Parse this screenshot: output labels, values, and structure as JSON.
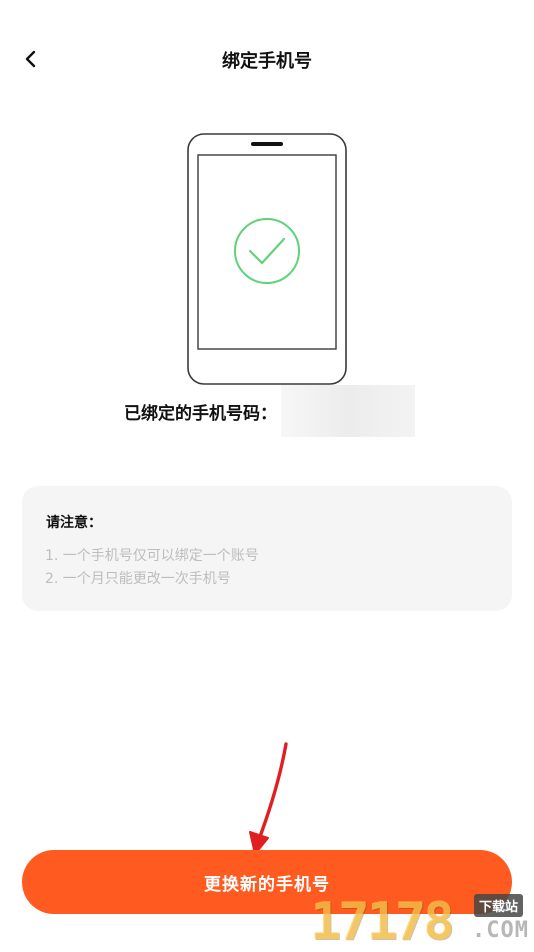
{
  "header": {
    "title": "绑定手机号",
    "back_icon": "chevron-left-icon"
  },
  "illustration": {
    "icon": "phone-check-icon",
    "check_color": "#5fd27a",
    "outline_color": "#3a3a3a"
  },
  "bound_phone": {
    "label": "已绑定的手机号码：",
    "value": ""
  },
  "notice": {
    "title": "请注意：",
    "items": [
      "1. 一个手机号仅可以绑定一个账号",
      "2. 一个月只能更改一次手机号"
    ]
  },
  "actions": {
    "change_phone_label": "更换新的手机号"
  },
  "watermark": {
    "digits": "17178",
    "tag": "下载站",
    "domain": ".COM"
  },
  "colors": {
    "accent": "#ff5a1f",
    "card_bg": "#f5f5f5",
    "muted_text": "#bdbdbd",
    "annotation_arrow": "#e02020"
  }
}
